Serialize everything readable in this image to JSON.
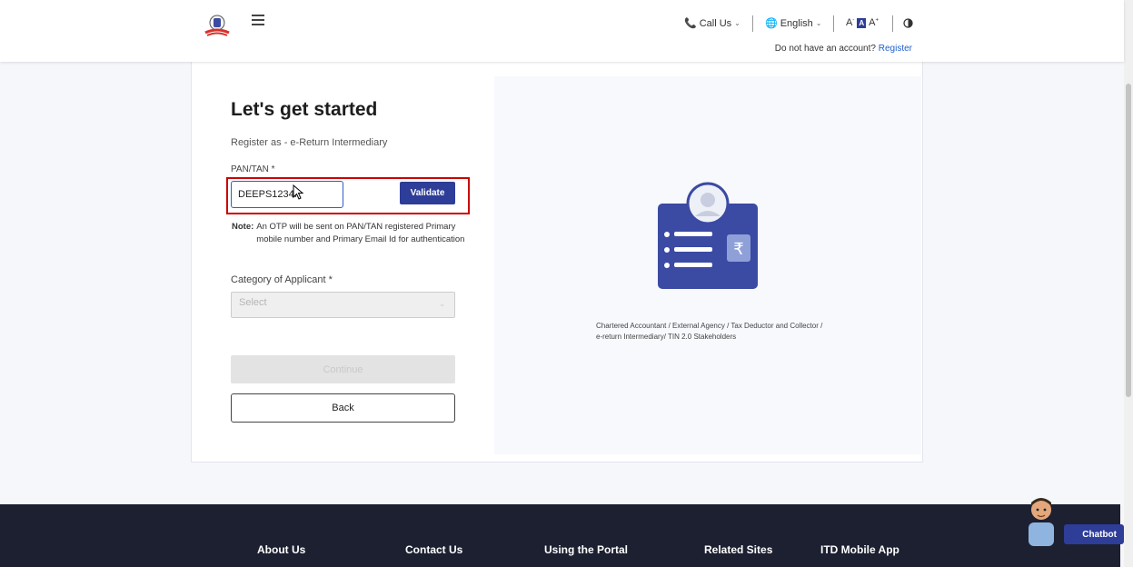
{
  "header": {
    "call_us": "Call Us",
    "language": "English",
    "font_small": "A",
    "font_normal": "A",
    "font_large": "A",
    "no_account_text": "Do not have an account?",
    "register_link": "Register"
  },
  "form": {
    "title": "Let's get started",
    "subtitle": "Register as - e-Return Intermediary",
    "pan_label": "PAN/TAN *",
    "pan_value": "DEEPS1234I",
    "validate_label": "Validate",
    "note_label": "Note:",
    "note_text": "An OTP will be sent on PAN/TAN registered Primary mobile number and Primary Email Id for authentication",
    "category_label": "Category of Applicant *",
    "category_placeholder": "Select",
    "continue_label": "Continue",
    "back_label": "Back"
  },
  "right_panel": {
    "description": "Chartered Accountant / External Agency / Tax Deductor and Collector / e-return Intermediary/ TIN 2.0 Stakeholders"
  },
  "footer": {
    "links": [
      "About Us",
      "Contact Us",
      "Using the Portal",
      "Related Sites",
      "ITD Mobile App"
    ],
    "chatbot_label": "Chatbot"
  },
  "colors": {
    "primary": "#2e3d98",
    "highlight": "#cc0000",
    "footer_bg": "#1c2031",
    "link": "#1f5fcf"
  },
  "icons": [
    "emblem-logo",
    "hamburger-menu-icon",
    "phone-icon",
    "globe-icon",
    "contrast-icon",
    "rupee-card-illustration",
    "chatbot-avatar-icon",
    "mouse-cursor-icon"
  ]
}
